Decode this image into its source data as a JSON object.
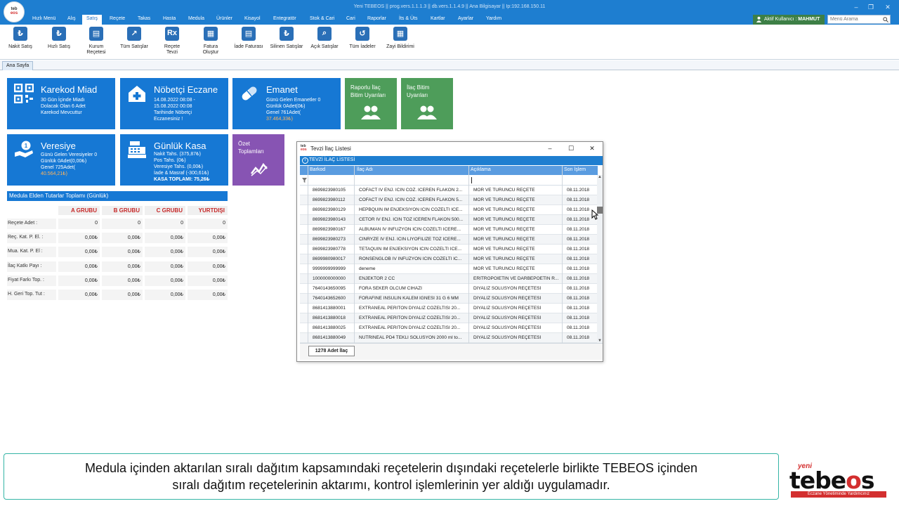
{
  "window": {
    "title": "Yeni TEBEOS  ||  prog.vers.1.1.1.3  ||  db.vers.1.1.4.9  ||  Ana Bilgisayar  ||  Ip:192.168.150.11",
    "logo_top": "teb",
    "logo_bottom": "eos"
  },
  "menu": {
    "items": [
      "Hızlı Menü",
      "Alış",
      "Satış",
      "Reçete",
      "Takas",
      "Hasta",
      "Medula",
      "Ürünler",
      "Kisayol",
      "Entegratör",
      "Stok & Cari",
      "Cari",
      "Raporlar",
      "İts & Üts",
      "Kartlar",
      "Ayarlar",
      "Yardım"
    ],
    "active": "Satış",
    "user_prefix": "Aktif Kullanıcı :",
    "user_name": "MAHMUT",
    "search_placeholder": "Menü Arama"
  },
  "ribbon": {
    "buttons": [
      {
        "label": "Nakit Satış",
        "icon": "cash-sale-icon"
      },
      {
        "label": "Hızlı Satış",
        "icon": "quick-sale-icon"
      },
      {
        "label": "Kurum Reçetesi",
        "icon": "institution-prescription-icon"
      },
      {
        "label": "Tüm Satışlar",
        "icon": "all-sales-icon"
      },
      {
        "label": "Reçete Tevzi",
        "icon": "prescription-distribution-icon"
      },
      {
        "label": "Fatura Oluştur",
        "icon": "create-invoice-icon"
      },
      {
        "label": "İade Faturası",
        "icon": "return-invoice-icon"
      },
      {
        "label": "Silinen Satışlar",
        "icon": "deleted-sales-icon"
      },
      {
        "label": "Açık Satışlar",
        "icon": "open-sales-icon"
      },
      {
        "label": "Tüm İadeler",
        "icon": "all-returns-icon"
      },
      {
        "label": "Zayi Bildirimi",
        "icon": "loss-report-icon"
      }
    ]
  },
  "tabs": {
    "home": "Ana Sayfa"
  },
  "tiles": {
    "karekod": {
      "title": "Karekod Miad",
      "lines": [
        "30 Gün İçinde Miadı",
        "Dolacak Olan 6 Adet",
        "Karekod Mevcuttur"
      ]
    },
    "nobetci": {
      "title": "Nöbetçi Eczane",
      "lines": [
        "14.08.2022 08:08 -",
        "15.08.2022 00:08",
        "Tarihinde Nöbetçi",
        "Eczanesiniz !"
      ]
    },
    "emanet": {
      "title": "Emanet",
      "lines": [
        "Günü Gelen Emanetler 0",
        "Günlük 0Adet(0₺)",
        "Genel 761Adet(",
        "37.464,33₺)"
      ]
    },
    "raporlu": {
      "title": "Raporlu İlaç Bitim Uyarıları"
    },
    "ilac_bitim": {
      "title": "İlaç Bitim Uyarıları"
    },
    "veresiye": {
      "title": "Veresiye",
      "lines": [
        "Günü Gelen Veresiyeler 0",
        "Günlük 0Adet(0,00₺)",
        "Genel 725Adet(",
        "40.564,21₺)"
      ]
    },
    "kasa": {
      "title": "Günlük Kasa",
      "lines": [
        "Nakit Tahs. (375,87₺)",
        "Pos Tahs. (0₺)",
        "Veresiye Tahs. (0,00₺)",
        "İade & Masraf (-300,61₺)",
        "KASA TOPLAMI: 75,26₺"
      ]
    },
    "ozet": {
      "title": "Özet Toplamları"
    }
  },
  "medula": {
    "title": "Medula Elden Tutarlar Toplamı (Günlük)",
    "columns": [
      "A GRUBU",
      "B GRUBU",
      "C GRUBU",
      "YURTDIŞI"
    ],
    "rows": [
      {
        "label": "Reçete Adet :",
        "values": [
          "0",
          "0",
          "0",
          "0"
        ]
      },
      {
        "label": "Reç. Kat. P. El. :",
        "values": [
          "0,00₺",
          "0,00₺",
          "0,00₺",
          "0,00₺"
        ]
      },
      {
        "label": "Mua. Kat. P. El :",
        "values": [
          "0,00₺",
          "0,00₺",
          "0,00₺",
          "0,00₺"
        ]
      },
      {
        "label": "İlaç Katkı Payı :",
        "values": [
          "0,00₺",
          "0,00₺",
          "0,00₺",
          "0,00₺"
        ]
      },
      {
        "label": "Fiyat Farkı Top. :",
        "values": [
          "0,00₺",
          "0,00₺",
          "0,00₺",
          "0,00₺"
        ]
      },
      {
        "label": "H. Geri Top. Tut :",
        "values": [
          "0,00₺",
          "0,00₺",
          "0,00₺",
          "0,00₺"
        ]
      }
    ]
  },
  "dialog": {
    "title": "Tevzi İlaç Listesi",
    "logo_top": "teb",
    "logo_bottom": "eos",
    "header": "TEVZİ İLAÇ LİSTESİ",
    "columns": [
      "Barkod",
      "İlaç Adı",
      "Açıklama",
      "Son İşlem"
    ],
    "rows": [
      [
        "8699823980105",
        "COFACT IV ENJ. ICIN COZ. ICEREN FLAKON 2...",
        "MOR VE TURUNCU REÇETE",
        "08.11.2018"
      ],
      [
        "8699823980112",
        "COFACT IV ENJ. ICIN COZ. ICEREN FLAKON 5...",
        "MOR VE TURUNCU REÇETE",
        "08.11.2018"
      ],
      [
        "8699823980129",
        "HEPBQUIN IM ENJEKSIYON ICIN COZELTI ICE...",
        "MOR VE TURUNCU REÇETE",
        "08.11.2018"
      ],
      [
        "8699823980143",
        "CETOR IV ENJ. ICIN TOZ ICEREN FLAKON 500...",
        "MOR VE TURUNCU REÇETE",
        "08.11.2018"
      ],
      [
        "8699823980167",
        "ALBUMAN IV INFUZYON ICIN COZELTI ICERE...",
        "MOR VE TURUNCU REÇETE",
        "08.11.2018"
      ],
      [
        "8699823980273",
        "CINRYZE IV ENJ. ICIN LIYOFILIZE TOZ ICERE...",
        "MOR VE TURUNCU REÇETE",
        "08.11.2018"
      ],
      [
        "8699823980778",
        "TETAQUIN IM ENJEKSIYON ICIN COZELTI ICE...",
        "MOR VE TURUNCU REÇETE",
        "08.11.2018"
      ],
      [
        "8699980980017",
        "RONSENGLOB IV INFUZYON ICIN COZELTI IC...",
        "MOR VE TURUNCU REÇETE",
        "08.11.2018"
      ],
      [
        "9999999999999",
        "deneme",
        "MOR VE TURUNCU REÇETE",
        "08.11.2018"
      ],
      [
        "1000000000000",
        "ENJEKTOR 2 CC",
        "ERİTROPOİETİN VE DARBEPOETİN R...",
        "08.11.2018"
      ],
      [
        "7640143650095",
        "FORA SEKER OLCUM CIHAZI",
        "DİYALİZ SOLUSYON REÇETESİ",
        "08.11.2018"
      ],
      [
        "7640143652600",
        "FORAFINE INSULIN KALEM IGNESI 31 G 6 MM",
        "DİYALİZ SOLUSYON REÇETESİ",
        "08.11.2018"
      ],
      [
        "8681413880001",
        "EXTRANEAL PERITON DIYALIZ COZELTISI  20...",
        "DİYALİZ SOLUSYON REÇETESİ",
        "08.11.2018"
      ],
      [
        "8681413880018",
        "EXTRANEAL PERITON DIYALIZ COZELTISI  20...",
        "DİYALİZ SOLUSYON REÇETESİ",
        "08.11.2018"
      ],
      [
        "8681413880025",
        "EXTRANEAL PERITON DIYALIZ COZELTISI  20...",
        "DİYALİZ SOLUSYON REÇETESİ",
        "08.11.2018"
      ],
      [
        "8681413880049",
        "NUTRINEAL PD4 TEKLI SOLUSYON  2000 ml to...",
        "DİYALİZ SOLUSYON REÇETESİ",
        "08.11.2018"
      ]
    ],
    "count": "1278 Adet İlaç"
  },
  "caption": {
    "line1": "Medula içinden aktarılan sıralı dağıtım kapsamındaki reçetelerin dışındaki reçetelerle birlikte TEBEOS içinden",
    "line2": "sıralı dağıtım reçetelerinin aktarımı, kontrol işlemlerinin yer aldığı uygulamadır."
  },
  "brand": {
    "yeni": "yeni",
    "name_left": "tebe",
    "name_accent": "o",
    "name_right": "s",
    "slogan": "Eczane Yönetiminde Yardımcınız"
  },
  "colors": {
    "menu_blue": "#1e7ed0",
    "tile_blue": "#1678d4",
    "tile_green": "#4e9d5a",
    "tile_purple": "#8754b3",
    "brand_red": "#d32f2f",
    "caption_border": "#35b5a6"
  }
}
